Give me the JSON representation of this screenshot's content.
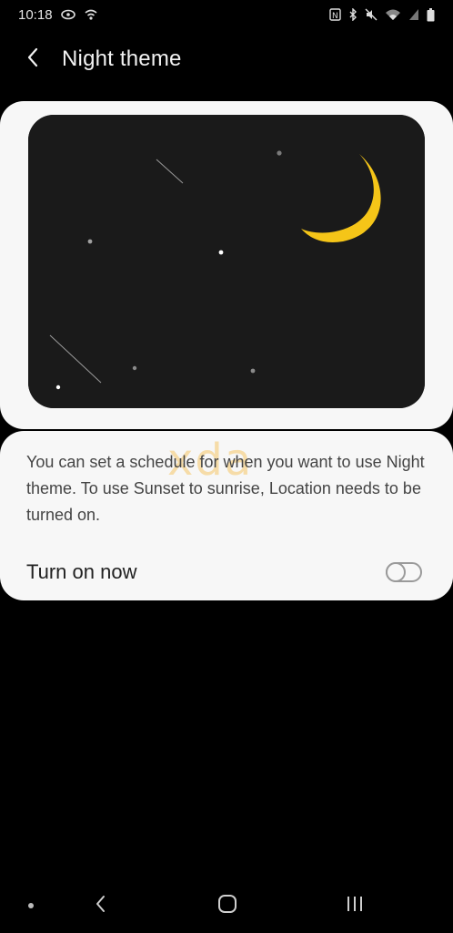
{
  "status_bar": {
    "time": "10:18",
    "left_icons": [
      "sync-icon",
      "wifi-call-icon"
    ],
    "right_icons": [
      "nfc-icon",
      "bluetooth-icon",
      "mute-icon",
      "wifi-icon",
      "signal-icon",
      "battery-icon"
    ]
  },
  "header": {
    "back_icon": "chevron-left-icon",
    "title": "Night theme"
  },
  "illustration": {
    "moon_color": "#f5c518",
    "sky_color": "#1a1a1a"
  },
  "info": {
    "description": "You can set a schedule for when you want to use Night theme. To use Sunset to sunrise, Location needs to be turned on.",
    "watermark": "xda",
    "toggle_label": "Turn on now",
    "toggle_on": false
  },
  "nav_bar": {
    "items": [
      "dot-icon",
      "back-icon",
      "home-icon",
      "recents-icon"
    ]
  }
}
